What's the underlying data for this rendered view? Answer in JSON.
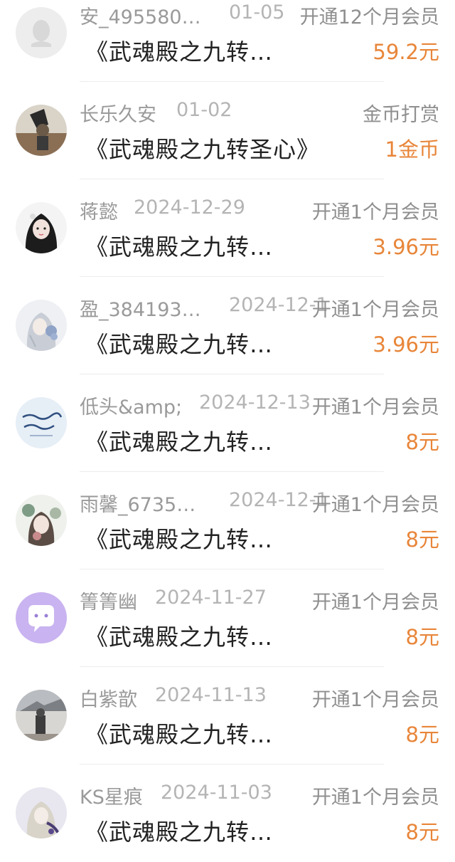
{
  "colors": {
    "amount": "#e8863a",
    "name": "#9a9a9a",
    "date": "#b4b4b4",
    "title": "#222222"
  },
  "items": [
    {
      "name": "安_495580…",
      "date": "01-05",
      "action": "开通12个月会员",
      "book": "《武魂殿之九转…",
      "amount": "59.2元",
      "avatar_icon": "default-user-icon"
    },
    {
      "name": "长乐久安",
      "date": "01-02",
      "action": "金币打赏",
      "book": "《武魂殿之九转圣心》",
      "amount": "1金币",
      "avatar_icon": "user-photo-icon"
    },
    {
      "name": "蒋懿",
      "date": "2024-12-29",
      "action": "开通1个月会员",
      "book": "《武魂殿之九转…",
      "amount": "3.96元",
      "avatar_icon": "user-photo-icon"
    },
    {
      "name": "盈_384193…",
      "date": "2024-12-1",
      "action": "开通1个月会员",
      "book": "《武魂殿之九转…",
      "amount": "3.96元",
      "avatar_icon": "user-photo-icon"
    },
    {
      "name": "低头&amp;",
      "date": "2024-12-13",
      "action": "开通1个月会员",
      "book": "《武魂殿之九转…",
      "amount": "8元",
      "avatar_icon": "user-photo-icon"
    },
    {
      "name": "雨馨_6735…",
      "date": "2024-12-1",
      "action": "开通1个月会员",
      "book": "《武魂殿之九转…",
      "amount": "8元",
      "avatar_icon": "user-photo-icon"
    },
    {
      "name": "箐箐幽",
      "date": "2024-11-27",
      "action": "开通1个月会员",
      "book": "《武魂殿之九转…",
      "amount": "8元",
      "avatar_icon": "chat-bubble-avatar-icon"
    },
    {
      "name": "白紫歆",
      "date": "2024-11-13",
      "action": "开通1个月会员",
      "book": "《武魂殿之九转…",
      "amount": "8元",
      "avatar_icon": "user-photo-icon"
    },
    {
      "name": "KS星痕",
      "date": "2024-11-03",
      "action": "开通1个月会员",
      "book": "《武魂殿之九转…",
      "amount": "8元",
      "avatar_icon": "user-photo-icon"
    }
  ]
}
